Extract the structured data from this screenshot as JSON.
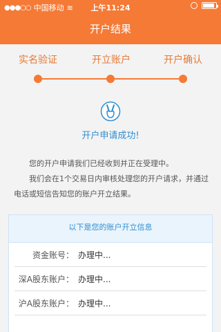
{
  "status": {
    "carrier": "中国移动",
    "time": "上午11:24"
  },
  "nav": {
    "title": "开户结果"
  },
  "steps": [
    {
      "label": "实名验证"
    },
    {
      "label": "开立账户"
    },
    {
      "label": "开户确认"
    }
  ],
  "result": {
    "title": "开户申请成功!",
    "desc1": "您的开户申请我们已经收到并正在受理中。",
    "desc2": "我们会在1个交易日内审核处理您的开户请求，并通过电话或短信告知您的账户开立结果。"
  },
  "info": {
    "header": "以下是您的账户开立信息",
    "rows": [
      {
        "label": "资金账号：",
        "value": "办理中..."
      },
      {
        "label": "深A股东账户：",
        "value": "办理中..."
      },
      {
        "label": "沪A股东账户：",
        "value": "办理中..."
      },
      {
        "label": "",
        "value": ""
      }
    ]
  },
  "colors": {
    "accent": "#f47a36",
    "link": "#2f8ed0"
  }
}
